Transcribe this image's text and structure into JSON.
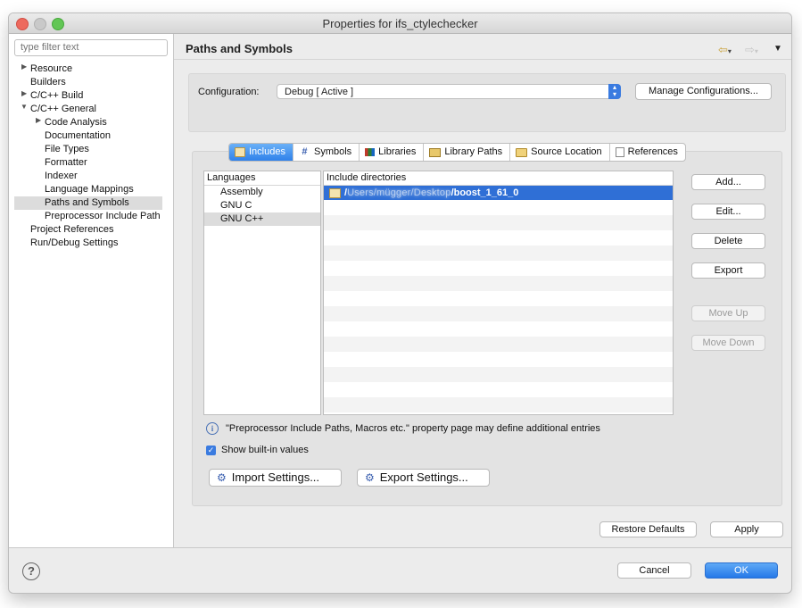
{
  "window": {
    "title": "Properties for ifs_ctylechecker"
  },
  "sidebar": {
    "filter_placeholder": "type filter text",
    "items": [
      {
        "label": "Resource"
      },
      {
        "label": "Builders"
      },
      {
        "label": "C/C++ Build"
      },
      {
        "label": "C/C++ General"
      },
      {
        "label": "Code Analysis"
      },
      {
        "label": "Documentation"
      },
      {
        "label": "File Types"
      },
      {
        "label": "Formatter"
      },
      {
        "label": "Indexer"
      },
      {
        "label": "Language Mappings"
      },
      {
        "label": "Paths and Symbols"
      },
      {
        "label": "Preprocessor Include Path"
      },
      {
        "label": "Project References"
      },
      {
        "label": "Run/Debug Settings"
      }
    ]
  },
  "page": {
    "title": "Paths and Symbols",
    "config_label": "Configuration:",
    "config_value": "Debug  [ Active ]",
    "manage_button": "Manage Configurations...",
    "tabs": [
      {
        "label": "Includes",
        "icon": "includes-icon"
      },
      {
        "label": "Symbols",
        "icon": "hash-icon"
      },
      {
        "label": "Libraries",
        "icon": "libraries-icon"
      },
      {
        "label": "Library Paths",
        "icon": "library-paths-icon"
      },
      {
        "label": "Source Location",
        "icon": "folder-icon"
      },
      {
        "label": "References",
        "icon": "references-icon"
      }
    ],
    "languages_header": "Languages",
    "languages": [
      "Assembly",
      "GNU C",
      "GNU C++"
    ],
    "dirs_header": "Include directories",
    "dir_prefix": "/",
    "dir_blurred": "Users/mügger/Desktop",
    "dir_suffix": "/boost_1_61_0",
    "side_buttons": {
      "add": "Add...",
      "edit": "Edit...",
      "delete": "Delete",
      "export": "Export",
      "move_up": "Move Up",
      "move_down": "Move Down"
    },
    "info_text": "\"Preprocessor Include Paths, Macros etc.\" property page may define additional entries",
    "show_builtin": "Show built-in values",
    "import_settings": "Import Settings...",
    "export_settings": "Export Settings...",
    "restore_defaults": "Restore Defaults",
    "apply": "Apply"
  },
  "footer": {
    "help": "?",
    "cancel": "Cancel",
    "ok": "OK"
  },
  "colors": {
    "accent": "#2f81ea",
    "selection": "#2f6fd6"
  }
}
